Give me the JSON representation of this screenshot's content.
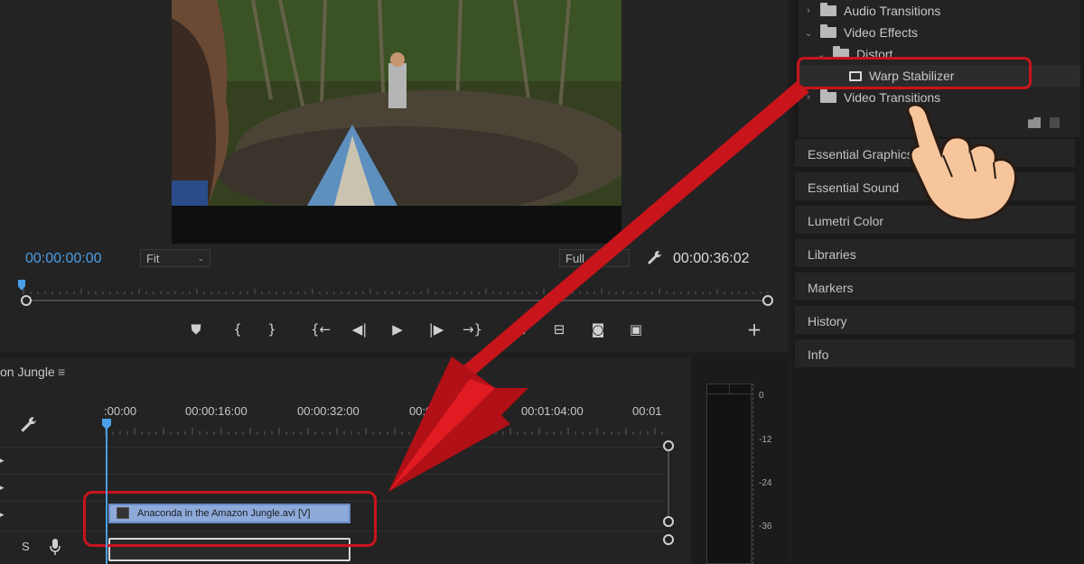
{
  "monitor": {
    "timecode_current": "00:00:00:00",
    "zoom_select": "Fit",
    "resolution_select": "Full",
    "timecode_duration": "00:00:36:02"
  },
  "transport": {
    "add_marker": "⛊",
    "mark_in": "{",
    "mark_out": "}",
    "go_to_in": "{←",
    "step_back": "◀|",
    "play": "▶",
    "step_forward": "|▶",
    "go_to_out": "→}",
    "lift": "⊞",
    "extract": "⊟",
    "export_frame": "◙",
    "compare": "▣",
    "add": "+"
  },
  "effects_tree": {
    "items": [
      {
        "label": "Audio Transitions",
        "chevron": "›"
      },
      {
        "label": "Video Effects",
        "chevron": "⌄"
      },
      {
        "label": "Distort",
        "chevron": "⌄"
      },
      {
        "label": "Warp Stabilizer"
      },
      {
        "label": "Video Transitions",
        "chevron": "›"
      }
    ]
  },
  "panels": [
    "Essential Graphics",
    "Essential Sound",
    "Lumetri Color",
    "Libraries",
    "Markers",
    "History",
    "Info"
  ],
  "timeline": {
    "sequence_name": "on Jungle",
    "menu_glyph": "≡",
    "ruler_labels": [
      ":00:00",
      "00:00:16:00",
      "00:00:32:00",
      "00:00:4",
      "00:01:04:00",
      "00:01"
    ],
    "clip_video_label": "Anaconda in the Amazon Jungle.avi [V]",
    "solo_label": "S"
  },
  "meter": {
    "db_labels": [
      "0",
      "-12",
      "-24",
      "-36"
    ]
  },
  "colors": {
    "accent_blue": "#4a9fe8",
    "highlight_red": "#c8141b",
    "clip_blue": "#8eaadb"
  }
}
